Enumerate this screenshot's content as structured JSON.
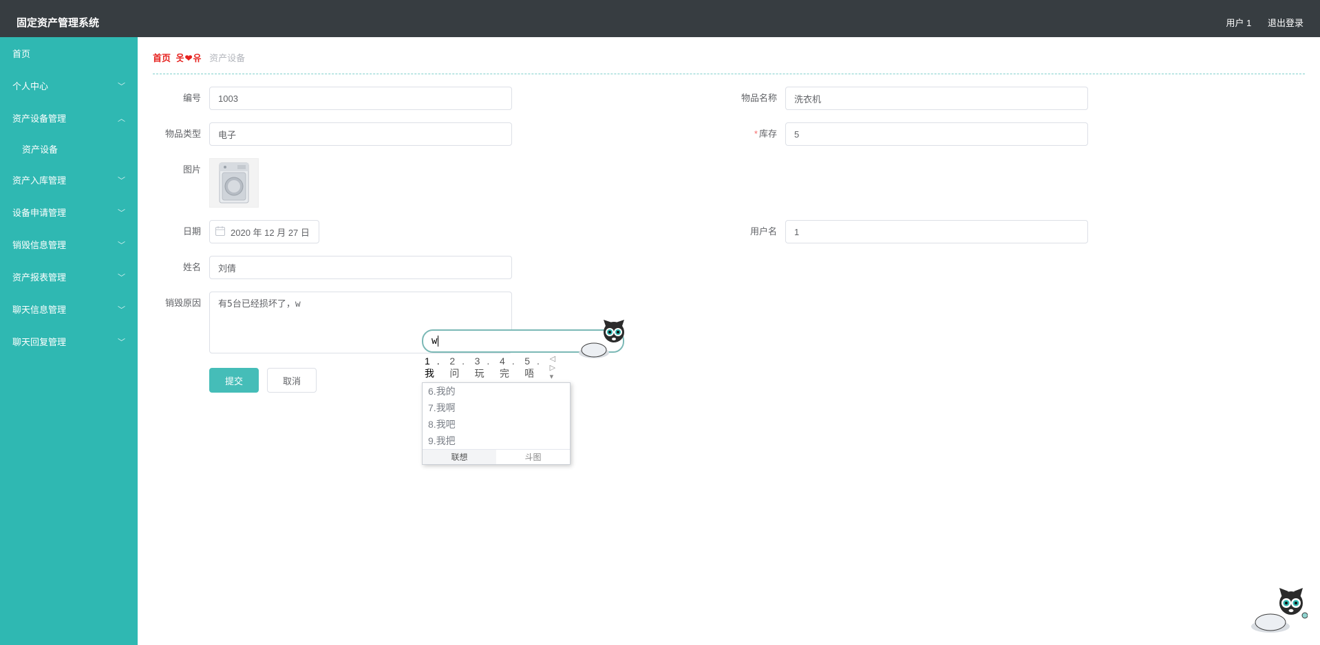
{
  "header": {
    "brand": "固定资产管理系统",
    "user_label": "用户 1",
    "logout_label": "退出登录"
  },
  "sidebar": {
    "items": [
      {
        "label": "首页",
        "expandable": false
      },
      {
        "label": "个人中心",
        "expandable": true,
        "expanded": false
      },
      {
        "label": "资产设备管理",
        "expandable": true,
        "expanded": true,
        "children": [
          {
            "label": "资产设备"
          }
        ]
      },
      {
        "label": "资产入库管理",
        "expandable": true,
        "expanded": false
      },
      {
        "label": "设备申请管理",
        "expandable": true,
        "expanded": false
      },
      {
        "label": "销毁信息管理",
        "expandable": true,
        "expanded": false
      },
      {
        "label": "资产报表管理",
        "expandable": true,
        "expanded": false
      },
      {
        "label": "聊天信息管理",
        "expandable": true,
        "expanded": false
      },
      {
        "label": "聊天回复管理",
        "expandable": true,
        "expanded": false
      }
    ]
  },
  "breadcrumb": {
    "home": "首页",
    "decor_left": "옷",
    "decor_heart": "❤",
    "decor_right": "유",
    "current": "资产设备"
  },
  "form": {
    "labels": {
      "id": "编号",
      "name": "物品名称",
      "type": "物品类型",
      "stock": "库存",
      "image": "图片",
      "date": "日期",
      "username": "用户名",
      "realname": "姓名",
      "reason": "销毁原因"
    },
    "values": {
      "id": "1003",
      "name": "洗衣机",
      "type": "电子",
      "stock": "5",
      "date": "2020 年 12 月 27 日",
      "username": "1",
      "realname": "刘倩",
      "reason": "有5台已经损坏了，w"
    },
    "buttons": {
      "submit": "提交",
      "cancel": "取消"
    }
  },
  "ime": {
    "typed": "w",
    "row1": [
      {
        "n": "1",
        "t": "我"
      },
      {
        "n": "2",
        "t": "问"
      },
      {
        "n": "3",
        "t": "玩"
      },
      {
        "n": "4",
        "t": "完"
      },
      {
        "n": "5",
        "t": "唔"
      }
    ],
    "more": [
      {
        "n": "6",
        "t": "我的"
      },
      {
        "n": "7",
        "t": "我啊"
      },
      {
        "n": "8",
        "t": "我吧"
      },
      {
        "n": "9",
        "t": "我把"
      }
    ],
    "tabs": {
      "assoc": "联想",
      "doutu": "斗图"
    }
  }
}
